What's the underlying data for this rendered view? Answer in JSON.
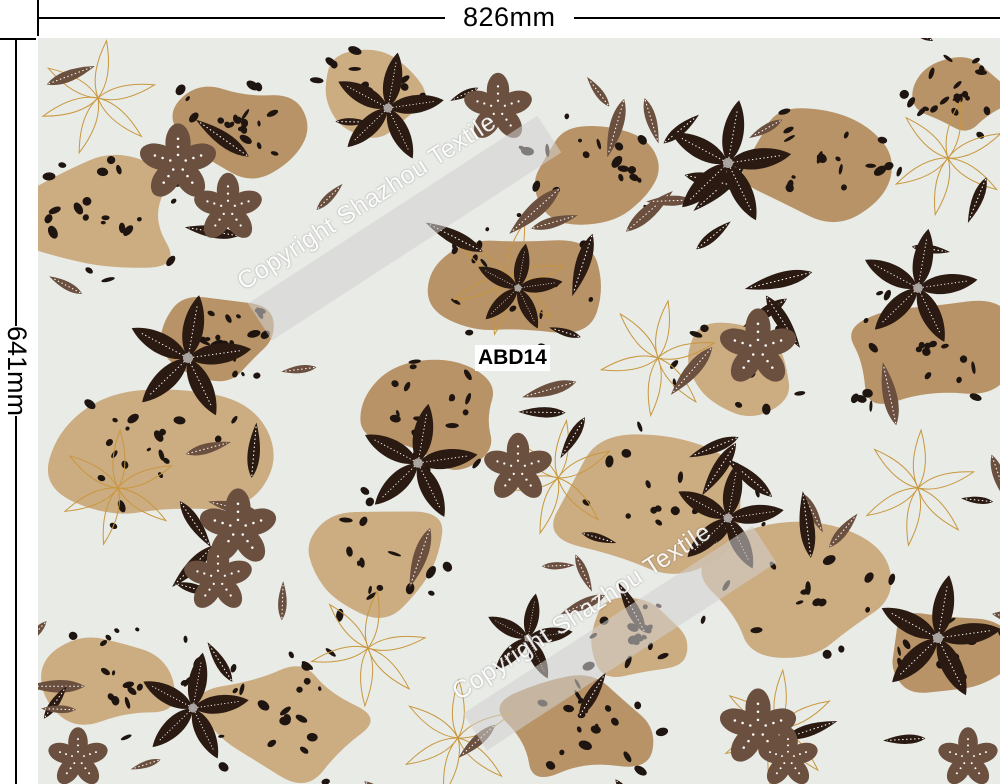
{
  "dimensions": {
    "width_label": "826mm",
    "height_label": "641mm"
  },
  "design": {
    "code": "ABD14"
  },
  "watermarks": [
    "Copyright Shazhou Textile",
    "Copyright Shazhou Textile"
  ],
  "colors": {
    "background": "#e9ebe6",
    "tan": "#c9a678",
    "tan_dark": "#b28b5c",
    "brown": "#6b5040",
    "dark_brown": "#2a1a12",
    "leopard_spot": "#1e1410",
    "outline_gold": "#c8973e"
  },
  "icons": [
    "flower-icon",
    "leaf-icon",
    "leopard-spot-icon"
  ]
}
